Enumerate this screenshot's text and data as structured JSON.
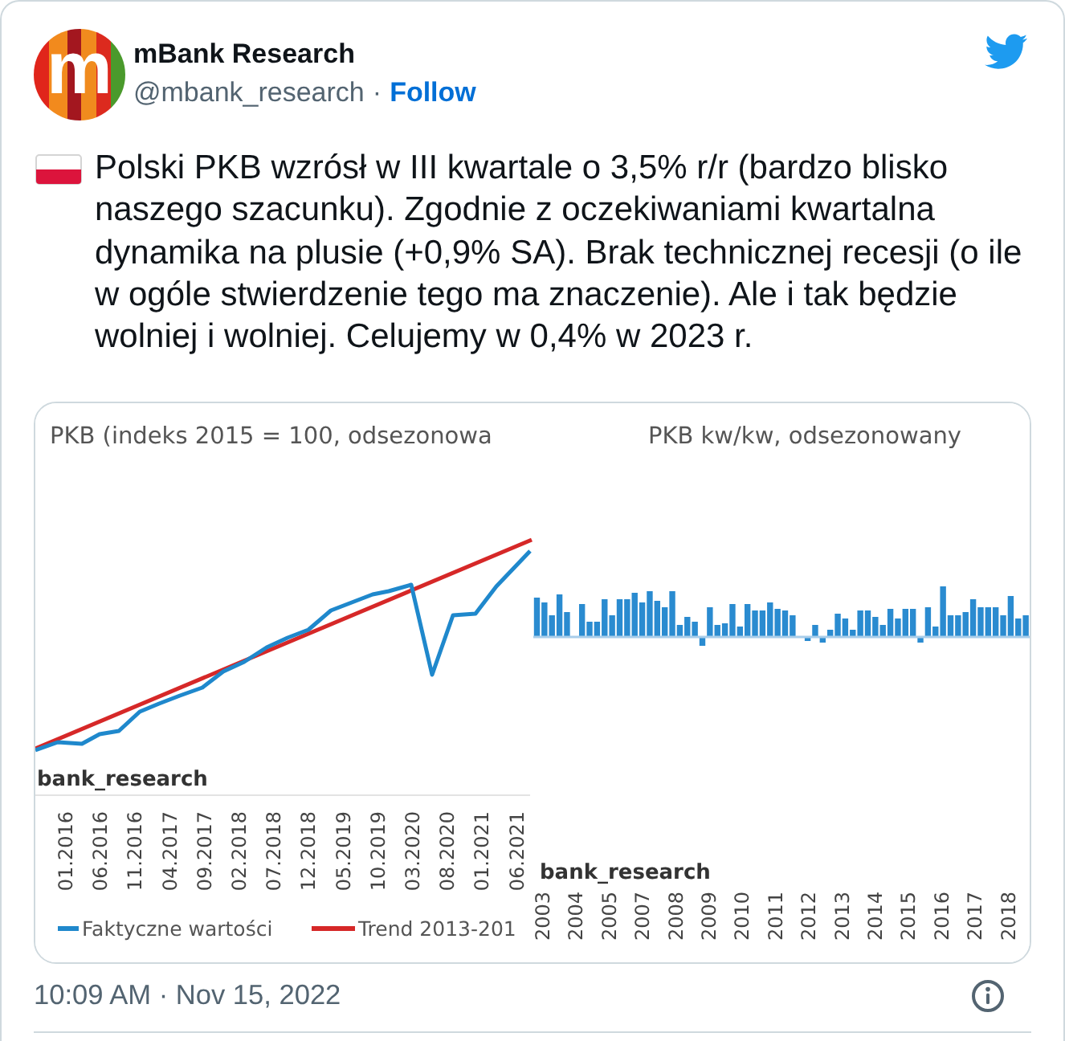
{
  "author": {
    "avatar_letter": "m",
    "name": "mBank Research",
    "handle": "@mbank_research",
    "separator": "·",
    "follow": "Follow"
  },
  "tweet": {
    "text": "Polski PKB wzrósł w III kwartale o 3,5% r/r (bardzo blisko naszego szacunku). Zgodnie z oczekiwaniami kwartalna dynamika na plusie (+0,9% SA). Brak technicznej recesji (o ile w ogóle stwierdzenie tego ma znaczenie). Ale i tak będzie wolniej i wolniej. Celujemy w 0,4% w 2023 r."
  },
  "media": {
    "left_chart": {
      "title": "PKB (indeks 2015 = 100, odsezonowa",
      "source": "bank_research",
      "x_labels": [
        "01.2016",
        "06.2016",
        "11.2016",
        "04.2017",
        "09.2017",
        "02.2018",
        "07.2018",
        "12.2018",
        "05.2019",
        "10.2019",
        "03.2020",
        "08.2020",
        "01.2021",
        "06.2021"
      ],
      "legend": [
        {
          "label": "Faktyczne wartości",
          "color": "#1f88cc"
        },
        {
          "label": "Trend 2013-201",
          "color": "#d62828"
        }
      ]
    },
    "right_chart": {
      "title": "PKB kw/kw, odsezonowany",
      "source": "bank_research",
      "x_labels": [
        "2003",
        "2004",
        "2005",
        "2007",
        "2008",
        "2009",
        "2010",
        "2011",
        "2012",
        "2013",
        "2014",
        "2015",
        "2016",
        "2017",
        "2018"
      ]
    }
  },
  "footer": {
    "timestamp": "10:09 AM · Nov 15, 2022"
  }
}
